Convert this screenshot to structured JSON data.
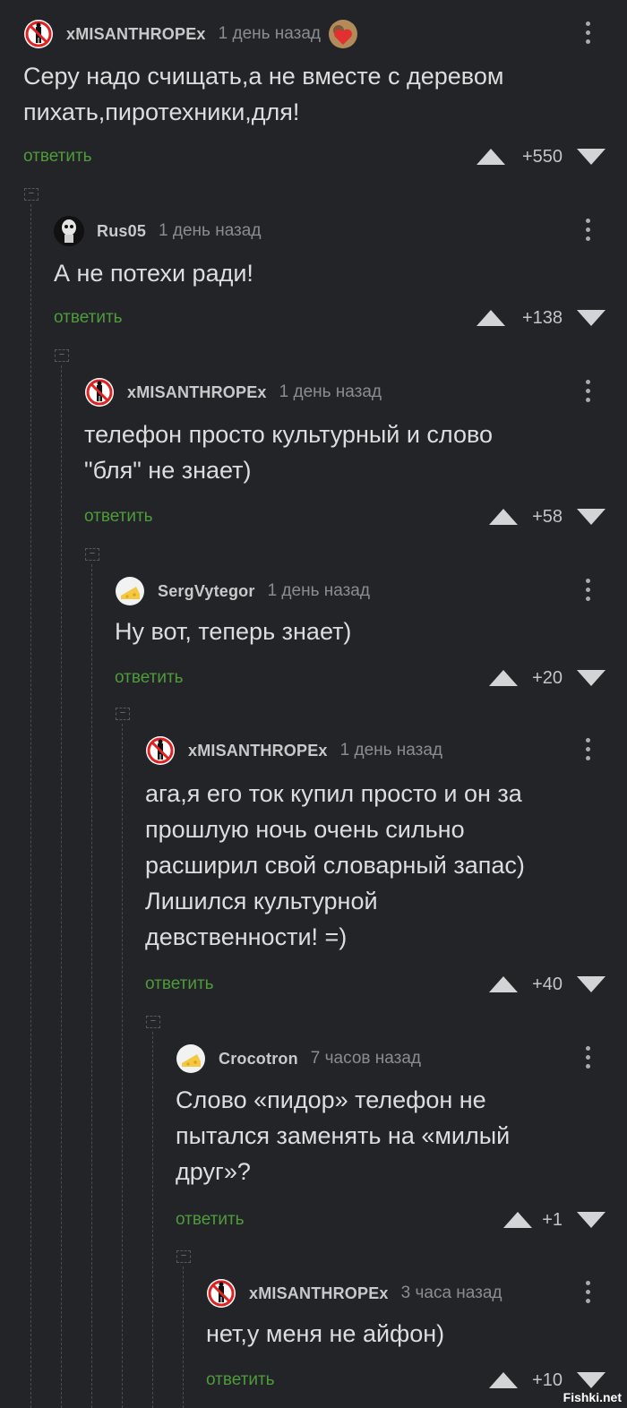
{
  "comments": [
    {
      "author": "xMISANTHROPEx",
      "time": "1 день назад",
      "lines": [
        "Серу надо счищать,а не вместе с деревом",
        "пихать,пиротехники,для!"
      ],
      "reply": "ответить",
      "rating": "+550",
      "avatar": "no-person-icon",
      "badge": "heart-badge-icon"
    },
    {
      "author": "Rus05",
      "time": "1 день назад",
      "lines": [
        "А не потехи ради!"
      ],
      "reply": "ответить",
      "rating": "+138",
      "avatar": "skull-avatar"
    },
    {
      "author": "xMISANTHROPEx",
      "time": "1 день назад",
      "lines": [
        "телефон просто культурный и слово",
        "\"бля\" не знает)"
      ],
      "reply": "ответить",
      "rating": "+58",
      "avatar": "no-person-icon"
    },
    {
      "author": "SergVytegor",
      "time": "1 день назад",
      "lines": [
        "Ну вот, теперь знает)"
      ],
      "reply": "ответить",
      "rating": "+20",
      "avatar": "cheese-avatar"
    },
    {
      "author": "xMISANTHROPEx",
      "time": "1 день назад",
      "lines": [
        "ага,я его ток купил просто и он за",
        "прошлую ночь очень сильно",
        "расширил свой словарный запас)",
        "Лишился культурной",
        "девственности! =)"
      ],
      "reply": "ответить",
      "rating": "+40",
      "avatar": "no-person-icon"
    },
    {
      "author": "Crocotron",
      "time": "7 часов назад",
      "lines": [
        "Слово «пидор» телефон не",
        "пытался заменять на «милый",
        "друг»?"
      ],
      "reply": "ответить",
      "rating": "+1",
      "avatar": "cheese-avatar"
    },
    {
      "author": "xMISANTHROPEx",
      "time": "3 часа назад",
      "lines": [
        "нет,у меня не айфон)"
      ],
      "reply": "ответить",
      "rating": "+10",
      "avatar": "no-person-icon"
    }
  ],
  "watermark": "Fishki.net",
  "colors": {
    "background": "#222427",
    "reply": "#4f9b3b",
    "text": "#dcdddf",
    "meta": "#8a8c8e"
  }
}
